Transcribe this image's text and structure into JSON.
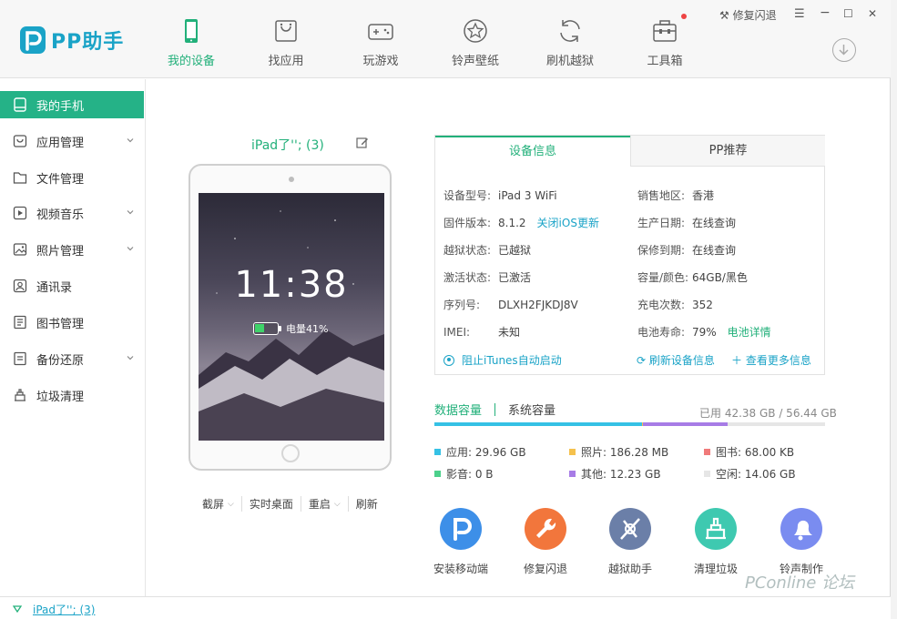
{
  "app": {
    "name": "PP助手"
  },
  "nav": [
    {
      "label": "我的设备",
      "icon": "phone-icon",
      "active": true
    },
    {
      "label": "找应用",
      "icon": "app-bag-icon"
    },
    {
      "label": "玩游戏",
      "icon": "gamepad-icon"
    },
    {
      "label": "铃声壁纸",
      "icon": "star-icon"
    },
    {
      "label": "刷机越狱",
      "icon": "refresh-cycle-icon"
    },
    {
      "label": "工具箱",
      "icon": "toolbox-icon"
    }
  ],
  "window": {
    "repair_label": "修复闪退",
    "menu": "☰",
    "minimize": "−",
    "maximize": "☐",
    "close": "✕"
  },
  "sidebar": [
    {
      "label": "我的手机",
      "icon": "phone-icon",
      "active": true
    },
    {
      "label": "应用管理",
      "icon": "app-icon",
      "chevron": true
    },
    {
      "label": "文件管理",
      "icon": "folder-icon"
    },
    {
      "label": "视频音乐",
      "icon": "play-icon",
      "chevron": true
    },
    {
      "label": "照片管理",
      "icon": "image-icon",
      "chevron": true
    },
    {
      "label": "通讯录",
      "icon": "contacts-icon"
    },
    {
      "label": "图书管理",
      "icon": "book-icon"
    },
    {
      "label": "备份还原",
      "icon": "backup-icon",
      "chevron": true
    },
    {
      "label": "垃圾清理",
      "icon": "trash-icon"
    }
  ],
  "device": {
    "name": "iPad了''; (3)",
    "time": "11:38",
    "battery_label": "电量41%",
    "battery_level": 0.41,
    "actions": [
      {
        "label": "截屏",
        "dropdown": true
      },
      {
        "label": "实时桌面",
        "dropdown": false
      },
      {
        "label": "重启",
        "dropdown": true
      },
      {
        "label": "刷新",
        "dropdown": false
      }
    ]
  },
  "info": {
    "tab_device": "设备信息",
    "tab_recommend": "PP推荐",
    "left": [
      {
        "k": "设备型号:",
        "v": "iPad 3 WiFi"
      },
      {
        "k": "固件版本:",
        "v": "8.1.2",
        "link": "关闭iOS更新"
      },
      {
        "k": "越狱状态:",
        "v": "已越狱"
      },
      {
        "k": "激活状态:",
        "v": "已激活"
      },
      {
        "k": "序列号:",
        "v": "DLXH2FJKDJ8V",
        "green": true
      },
      {
        "k": "IMEI:",
        "v": "未知"
      }
    ],
    "right": [
      {
        "k": "销售地区:",
        "v": "香港"
      },
      {
        "k": "生产日期:",
        "link": "在线查询"
      },
      {
        "k": "保修到期:",
        "link": "在线查询"
      },
      {
        "k": "容量/颜色:",
        "v": "64GB/黑色"
      },
      {
        "k": "充电次数:",
        "v": "352"
      },
      {
        "k": "电池寿命:",
        "v": "79%",
        "link": "电池详情"
      }
    ],
    "itunes": "阻止iTunes自动启动",
    "refresh": "刷新设备信息",
    "more": "查看更多信息"
  },
  "capacity": {
    "tab_data": "数据容量",
    "tab_system": "系统容量",
    "used": "已用 42.38 GB / 56.44 GB",
    "segments": [
      {
        "label": "应用: 29.96 GB",
        "color": "#35c1e5",
        "gb": 29.96
      },
      {
        "label": "照片: 186.28 MB",
        "color": "#f5c14d",
        "gb": 0.18
      },
      {
        "label": "图书: 68.00 KB",
        "color": "#f07a7a",
        "gb": 0.0
      },
      {
        "label": "影音: 0 B",
        "color": "#4cd08b",
        "gb": 0
      },
      {
        "label": "其他: 12.23 GB",
        "color": "#a77ce6",
        "gb": 12.23
      },
      {
        "label": "空闲: 14.06 GB",
        "color": "#e6e6e6",
        "gb": 14.06
      }
    ]
  },
  "tools": [
    {
      "label": "安装移动端",
      "color": "#3d8fe8",
      "icon": "pp-logo-icon"
    },
    {
      "label": "修复闪退",
      "color": "#f2763c",
      "icon": "wrench-icon"
    },
    {
      "label": "越狱助手",
      "color": "#6b7fa8",
      "icon": "jailbreak-icon"
    },
    {
      "label": "清理垃圾",
      "color": "#3ec9b0",
      "icon": "broom-icon"
    },
    {
      "label": "铃声制作",
      "color": "#7a8cf0",
      "icon": "bell-icon"
    }
  ],
  "footer": {
    "device": "iPad了''; (3)"
  },
  "watermark": "PConline 论坛"
}
